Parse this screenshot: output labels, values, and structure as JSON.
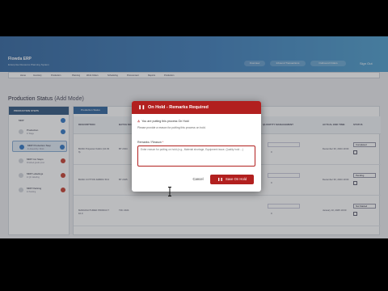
{
  "header": {
    "brand": "Flowda ERP",
    "subtitle": "Enterprise Resource Planning System",
    "pills": [
      "Overview",
      "Inbound Transactions",
      "Outbound Orders"
    ],
    "signout": "Sign Out"
  },
  "nav": {
    "items": [
      "Home",
      "Inventory",
      "Production",
      "Planning",
      "Work Orders",
      "Scheduling",
      "Procurement",
      "Reports",
      "Production"
    ]
  },
  "page": {
    "title": "Production Status",
    "mode": "(Add Mode)"
  },
  "steps": {
    "header": "PRODUCTION STEPS",
    "items": [
      {
        "label": "MRP",
        "sub": ""
      },
      {
        "label": "Production",
        "sub": "In Stage"
      },
      {
        "label": "MRP Production Step",
        "sub": "In Assembly / Work"
      },
      {
        "label": "MRP Cut Steps",
        "sub": "Finished goods prod"
      },
      {
        "label": "MRP Labelings",
        "sub": "In QC labelling"
      },
      {
        "label": "MRP Packing",
        "sub": "In Packing"
      }
    ]
  },
  "table": {
    "tab": "Production Status",
    "columns": [
      "DESCRIPTION",
      "BATCH NO",
      "QUANTITY MANAGEMENT",
      "ACTUAL END TIME",
      "STATUS"
    ],
    "rows": [
      {
        "desc": "BASIC Polyester Fabric (10.03 ft)",
        "batch": "BT 2044",
        "qty": "0",
        "time": "December 30, 2024 10:00",
        "status": "Completed"
      },
      {
        "desc": "BASIC COTTON FABRIC 50.0",
        "batch": "BT 2045",
        "qty": "0",
        "time": "December 30, 2024 10:00",
        "status": "Pending"
      },
      {
        "desc": "MANUFACTURED PRODUCT 10.0",
        "batch": "TZC 2024",
        "qty": "0",
        "time": "January 10, 2025 10:00",
        "status": "Not Started"
      }
    ]
  },
  "modal": {
    "icon": "pause-icon",
    "title": "On Hold - Remarks Required",
    "warning": "You are putting this process On Hold",
    "help": "Please provide a reason for putting this process on hold.",
    "field_label": "Remarks / Reason",
    "required_mark": "*",
    "placeholder": "Enter reason for putting on hold (e.g., Material shortage, Equipment issue, Quality hold ...)",
    "cancel": "Cancel",
    "save": "Save On Hold"
  },
  "colors": {
    "modal_accent": "#b2201f",
    "header_start": "#3e6fa5",
    "header_end": "#58a3cf"
  }
}
